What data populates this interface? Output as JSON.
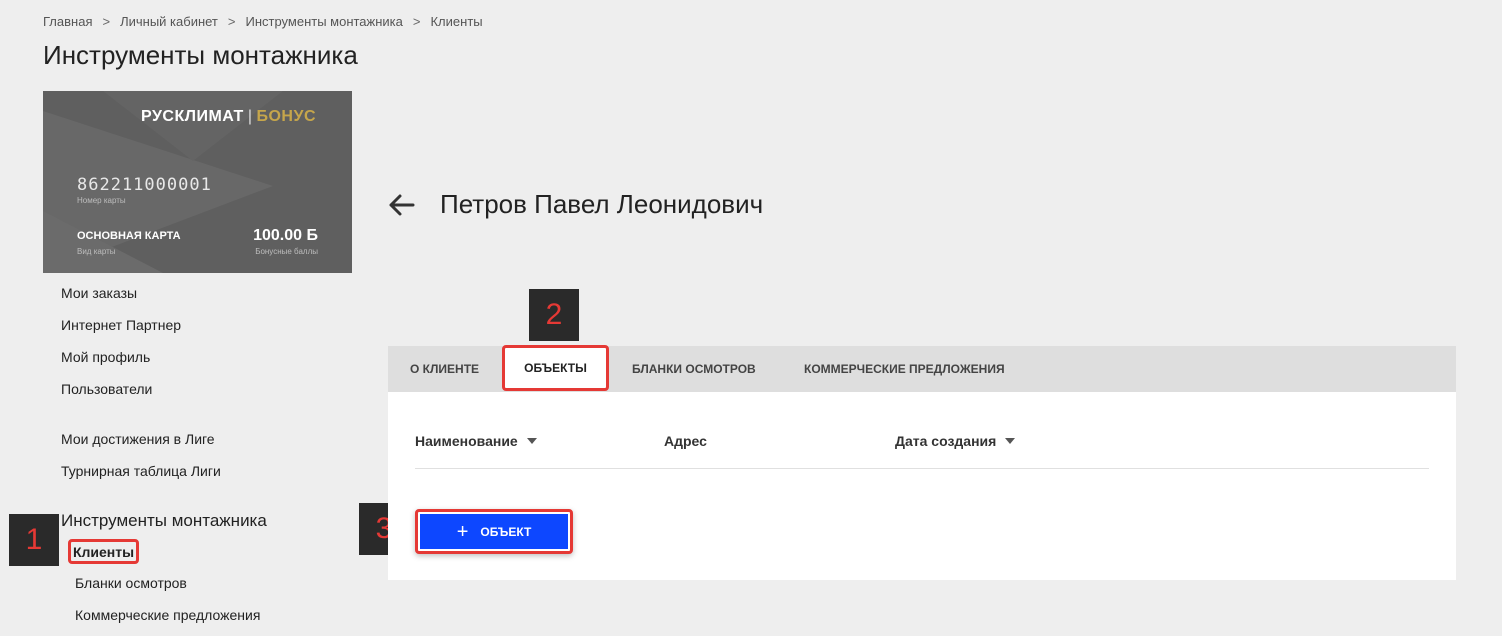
{
  "breadcrumb": [
    "Главная",
    "Личный кабинет",
    "Инструменты монтажника",
    "Клиенты"
  ],
  "breadcrumb_separator": ">",
  "page_title": "Инструменты монтажника",
  "card": {
    "brand_main": "РУСКЛИМАТ",
    "brand_separator": "|",
    "brand_accent": "БОНУС",
    "number": "862211000001",
    "number_caption": "Номер карты",
    "type": "ОСНОВНАЯ КАРТА",
    "type_caption": "Вид карты",
    "balance": "100.00 Б",
    "balance_caption": "Бонусные баллы",
    "background_color": "#5f5f5f",
    "accent_color": "#c6a64b"
  },
  "sidebar": {
    "items": [
      "Мои заказы",
      "Интернет Партнер",
      "Мой профиль",
      "Пользователи",
      "Мои достижения в Лиге",
      "Турнирная таблица Лиги"
    ],
    "group_title": "Инструменты монтажника",
    "sub_items": [
      "Клиенты",
      "Бланки осмотров",
      "Коммерческие предложения"
    ]
  },
  "annotations": [
    "1",
    "2",
    "3"
  ],
  "client": {
    "back_icon": "arrow-left-icon",
    "name": "Петров Павел Леонидович"
  },
  "tabs": [
    "О КЛИЕНТЕ",
    "ОБЪЕКТЫ",
    "БЛАНКИ ОСМОТРОВ",
    "КОММЕРЧЕСКИЕ ПРЕДЛОЖЕНИЯ"
  ],
  "active_tab": "ОБЪЕКТЫ",
  "table": {
    "columns": [
      "Наименование",
      "Адрес",
      "Дата создания"
    ]
  },
  "add_button": {
    "icon": "plus-icon",
    "label": "ОБЪЕКТ",
    "color": "#0d47ff"
  },
  "highlight_color": "#e53935"
}
